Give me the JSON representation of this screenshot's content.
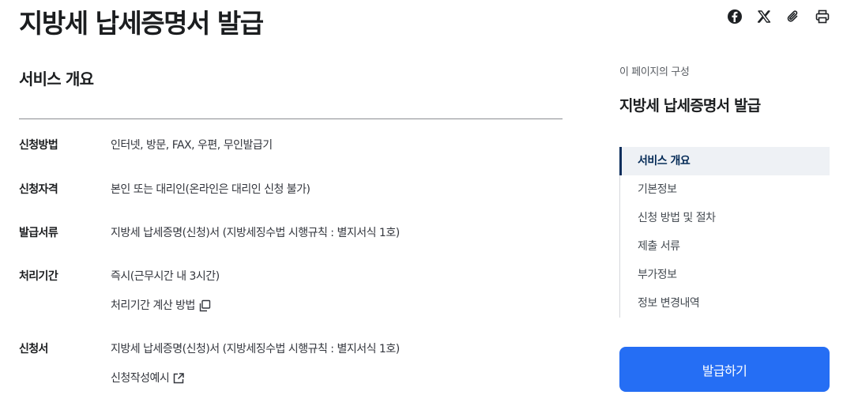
{
  "page": {
    "title": "지방세 납세증명서 발급"
  },
  "share": {
    "icons": [
      "facebook-icon",
      "x-icon",
      "clip-link-icon",
      "print-icon"
    ]
  },
  "overview": {
    "title": "서비스 개요",
    "rows": [
      {
        "label": "신청방법",
        "values": [
          "인터넷, 방문, FAX, 우편, 무인발급기"
        ]
      },
      {
        "label": "신청자격",
        "values": [
          "본인 또는 대리인(온라인은 대리인 신청 불가)"
        ]
      },
      {
        "label": "발급서류",
        "values": [
          "지방세 납세증명(신청)서 (지방세징수법 시행규칙 : 별지서식 1호)"
        ]
      },
      {
        "label": "처리기간",
        "values": [
          "즉시(근무시간 내 3시간)"
        ],
        "link": "처리기간 계산 방법"
      },
      {
        "label": "신청서",
        "values": [
          "지방세 납세증명(신청)서 (지방세징수법 시행규칙 : 별지서식 1호)"
        ],
        "link": "신청작성예시"
      }
    ]
  },
  "toc": {
    "caption": "이 페이지의 구성",
    "title": "지방세 납세증명서 발급",
    "items": [
      "서비스 개요",
      "기본정보",
      "신청 방법 및 절차",
      "제출 서류",
      "부가정보",
      "정보 변경내역"
    ],
    "active_index": 0
  },
  "actions": {
    "issue_label": "발급하기"
  },
  "colors": {
    "primary": "#256ef4",
    "toc_active_bar": "#0b2e5c",
    "toc_active_bg": "#eef1f5"
  }
}
